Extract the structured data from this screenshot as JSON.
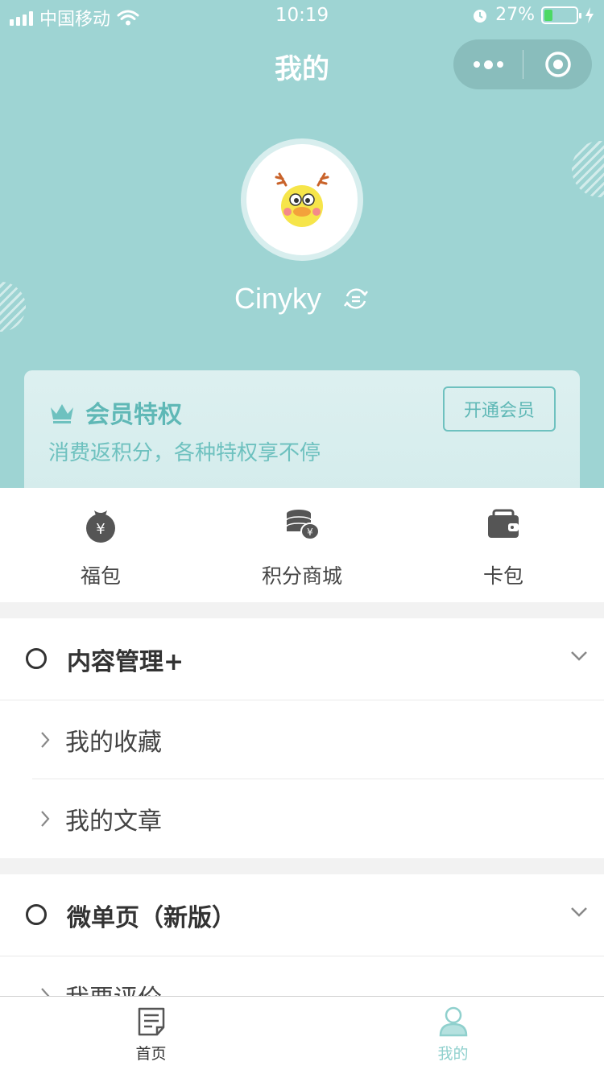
{
  "status_bar": {
    "carrier": "中国移动",
    "time": "10:19",
    "battery_percent": "27%",
    "battery_level": 0.27
  },
  "nav": {
    "title": "我的"
  },
  "profile": {
    "username": "Cinyky"
  },
  "vip": {
    "title": "会员特权",
    "subtitle": "消费返积分，各种特权享不停",
    "button": "开通会员"
  },
  "quick": [
    {
      "label": "福包",
      "icon": "lucky-bag-icon"
    },
    {
      "label": "积分商城",
      "icon": "coins-icon"
    },
    {
      "label": "卡包",
      "icon": "wallet-icon"
    }
  ],
  "sections": [
    {
      "title": "内容管理+",
      "items": [
        {
          "label": "我的收藏"
        },
        {
          "label": "我的文章"
        }
      ]
    },
    {
      "title": "微单页（新版）",
      "items": [
        {
          "label": "我要评价"
        }
      ]
    }
  ],
  "tabbar": {
    "tabs": [
      {
        "label": "首页",
        "icon": "document-icon",
        "active": false
      },
      {
        "label": "我的",
        "icon": "person-icon",
        "active": true
      }
    ]
  },
  "colors": {
    "theme": "#9ed4d3",
    "accent": "#6ec1bf",
    "active_tab": "#8fd0cd",
    "text_dark": "#333333"
  }
}
